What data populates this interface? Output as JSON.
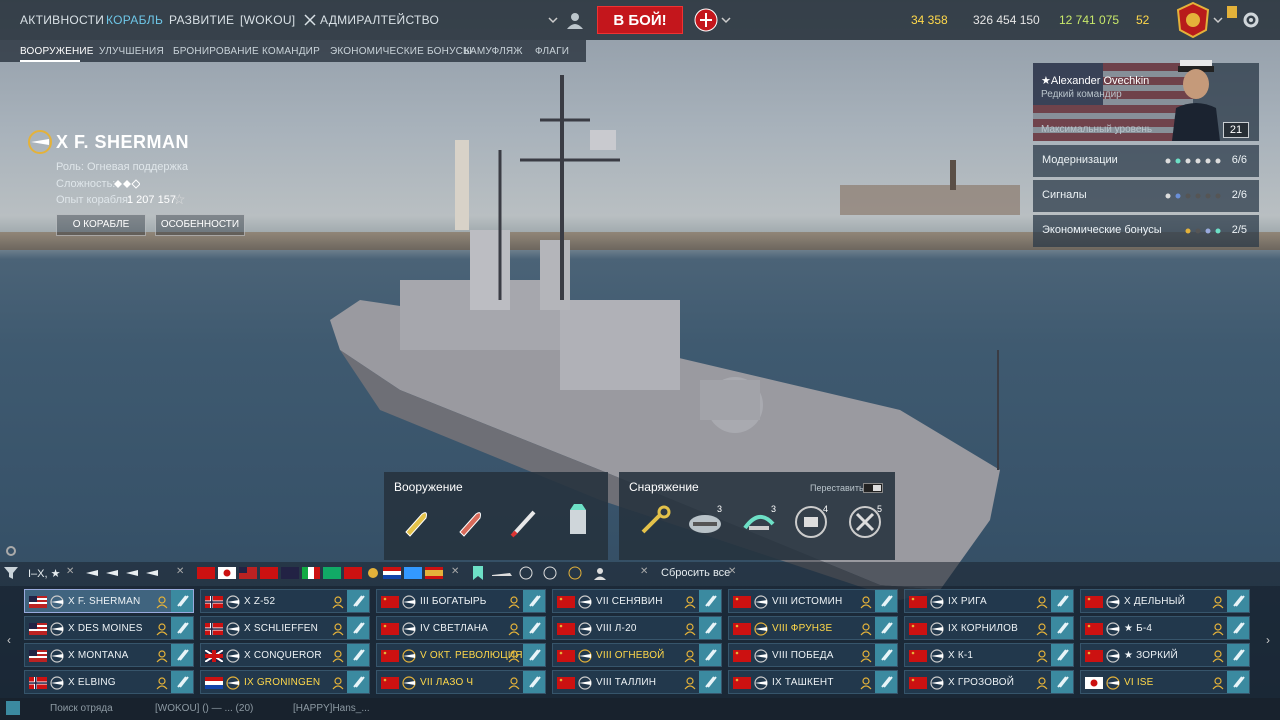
{
  "topnav": {
    "items": [
      {
        "label": "АКТИВНОСТИ",
        "active": false
      },
      {
        "label": "КОРАБЛЬ",
        "active": true
      },
      {
        "label": "РАЗВИТИЕ",
        "active": false
      },
      {
        "label": "[WOKOU]",
        "active": false
      },
      {
        "label": "АДМИРАЛТЕЙСТВО",
        "active": false
      }
    ],
    "battle_label": "В БОЙ!",
    "resources": {
      "doubloons": "34 358",
      "credits": "326 454 150",
      "free_xp": "12 741 075",
      "tokens": "52"
    }
  },
  "subnav": {
    "items": [
      "ВООРУЖЕНИЕ",
      "УЛУЧШЕНИЯ",
      "БРОНИРОВАНИЕ",
      "КОМАНДИР",
      "ЭКОНОМИЧЕСКИЕ БОНУСЫ",
      "КАМУФЛЯЖ",
      "ФЛАГИ"
    ]
  },
  "ship": {
    "name": "X F. SHERMAN",
    "role": "Роль: Огневая поддержка",
    "complexity": "Сложность:",
    "xp_label": "Опыт корабля:",
    "xp_value": "1 207 157",
    "btn_about": "О КОРАБЛЕ",
    "btn_features": "ОСОБЕННОСТИ"
  },
  "commander": {
    "name": "★Alexander Ovechkin",
    "rank": "Редкий командир",
    "level_label": "Максимальный уровень",
    "level": "21"
  },
  "rightpanel": [
    {
      "label": "Модернизации",
      "value": "6/6"
    },
    {
      "label": "Сигналы",
      "value": "2/6"
    },
    {
      "label": "Экономические бонусы",
      "value": "2/5"
    }
  ],
  "loadout": {
    "armament_title": "Вооружение",
    "consumables_title": "Снаряжение",
    "swap_label": "Переставить",
    "consumable_counts": [
      "3",
      "3",
      "4",
      "5"
    ]
  },
  "filter": {
    "tier_range": "I–X, ★",
    "reset_label": "Сбросить все"
  },
  "carousel": [
    {
      "name": "X F. SHERMAN",
      "flag": "us",
      "prem": false,
      "sel": true
    },
    {
      "name": "X DES MOINES",
      "flag": "us",
      "prem": false
    },
    {
      "name": "X MONTANA",
      "flag": "us",
      "prem": false
    },
    {
      "name": "X ELBING",
      "flag": "no",
      "prem": false
    },
    {
      "name": "X Z-52",
      "flag": "no",
      "prem": false
    },
    {
      "name": "X SCHLIEFFEN",
      "flag": "no",
      "prem": false
    },
    {
      "name": "X CONQUEROR",
      "flag": "uk",
      "prem": false
    },
    {
      "name": "IX GRONINGEN",
      "flag": "nl",
      "prem": true
    },
    {
      "name": "III БОГАТЫРЬ",
      "flag": "su",
      "prem": false
    },
    {
      "name": "IV СВЕТЛАНА",
      "flag": "su",
      "prem": false
    },
    {
      "name": "V ОКТ. РЕВОЛЮЦИЯ",
      "flag": "su",
      "prem": true
    },
    {
      "name": "VII ЛАЗО Ч",
      "flag": "su",
      "prem": true
    },
    {
      "name": "VII СЕНЯВИН",
      "flag": "su",
      "prem": false
    },
    {
      "name": "VIII Л-20",
      "flag": "su",
      "prem": false
    },
    {
      "name": "VIII ОГНЕВОЙ",
      "flag": "su",
      "prem": true
    },
    {
      "name": "VIII ТАЛЛИН",
      "flag": "su",
      "prem": false
    },
    {
      "name": "VIII ИСТОМИН",
      "flag": "su",
      "prem": false
    },
    {
      "name": "VIII ФРУНЗЕ",
      "flag": "su",
      "prem": true
    },
    {
      "name": "VIII ПОБЕДА",
      "flag": "su",
      "prem": false
    },
    {
      "name": "IX ТАШКЕНТ",
      "flag": "su",
      "prem": false
    },
    {
      "name": "IX РИГА",
      "flag": "su",
      "prem": false
    },
    {
      "name": "IX КОРНИЛОВ",
      "flag": "su",
      "prem": false
    },
    {
      "name": "X К-1",
      "flag": "su",
      "prem": false
    },
    {
      "name": "X ГРОЗОВОЙ",
      "flag": "su",
      "prem": false
    },
    {
      "name": "X ДЕЛЬНЫЙ",
      "flag": "su",
      "prem": false
    },
    {
      "name": "★ Б-4",
      "flag": "su",
      "prem": false
    },
    {
      "name": "★ ЗОРКИЙ",
      "flag": "su",
      "prem": false
    },
    {
      "name": "VI ISE",
      "flag": "jp",
      "prem": true
    }
  ],
  "bottom": {
    "search_placeholder": "Поиск отряда",
    "chat1": "[WOKOU] () — ... (20)",
    "chat2": "[HAPPY]Hans_..."
  },
  "colors": {
    "accent": "#6ec7e8",
    "battle": "#c4161c",
    "premium": "#ffd84a"
  }
}
